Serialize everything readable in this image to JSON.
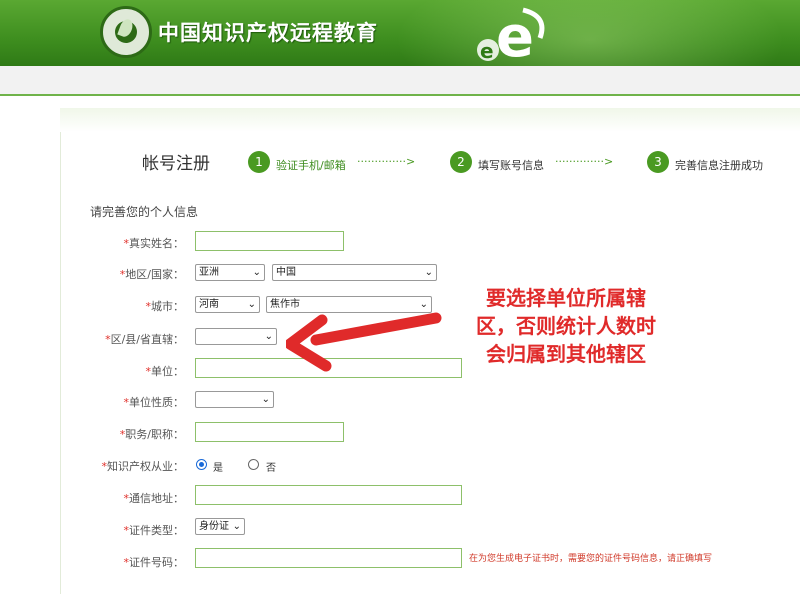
{
  "header": {
    "site_title": "中国知识产权远程教育",
    "logo_icon": "cepiec-seal-icon",
    "brand_color": "#3e8e1f"
  },
  "page": {
    "title": "帐号注册",
    "steps": [
      {
        "number": "1",
        "label": "验证手机/邮箱"
      },
      {
        "number": "2",
        "label": "填写账号信息"
      },
      {
        "number": "3",
        "label": "完善信息注册成功"
      }
    ],
    "step_separator": "··············>"
  },
  "form": {
    "section_title": "请完善您的个人信息",
    "required_mark": "*",
    "fields": {
      "real_name": {
        "label": "真实姓名：",
        "value": ""
      },
      "region": {
        "label": "地区/国家：",
        "continent": "亚洲",
        "country": "中国"
      },
      "city": {
        "label": "城市：",
        "province": "河南",
        "city": "焦作市"
      },
      "district": {
        "label": "区/县/省直辖：",
        "value": ""
      },
      "unit": {
        "label": "单位：",
        "value": ""
      },
      "unit_type": {
        "label": "单位性质：",
        "value": ""
      },
      "position": {
        "label": "职务/职称：",
        "value": ""
      },
      "ip_practitioner": {
        "label": "知识产权从业：",
        "options": [
          "是",
          "否"
        ],
        "selected": "是"
      },
      "address": {
        "label": "通信地址：",
        "value": ""
      },
      "id_type": {
        "label": "证件类型：",
        "value": "身份证"
      },
      "id_number": {
        "label": "证件号码：",
        "value": "",
        "hint": "在为您生成电子证书时，需要您的证件号码信息，请正确填写"
      }
    }
  },
  "annotation": {
    "lines": [
      "要选择单位所属辖",
      "区，否则统计人数时",
      "会归属到其他辖区"
    ],
    "color": "#e02a2a"
  }
}
